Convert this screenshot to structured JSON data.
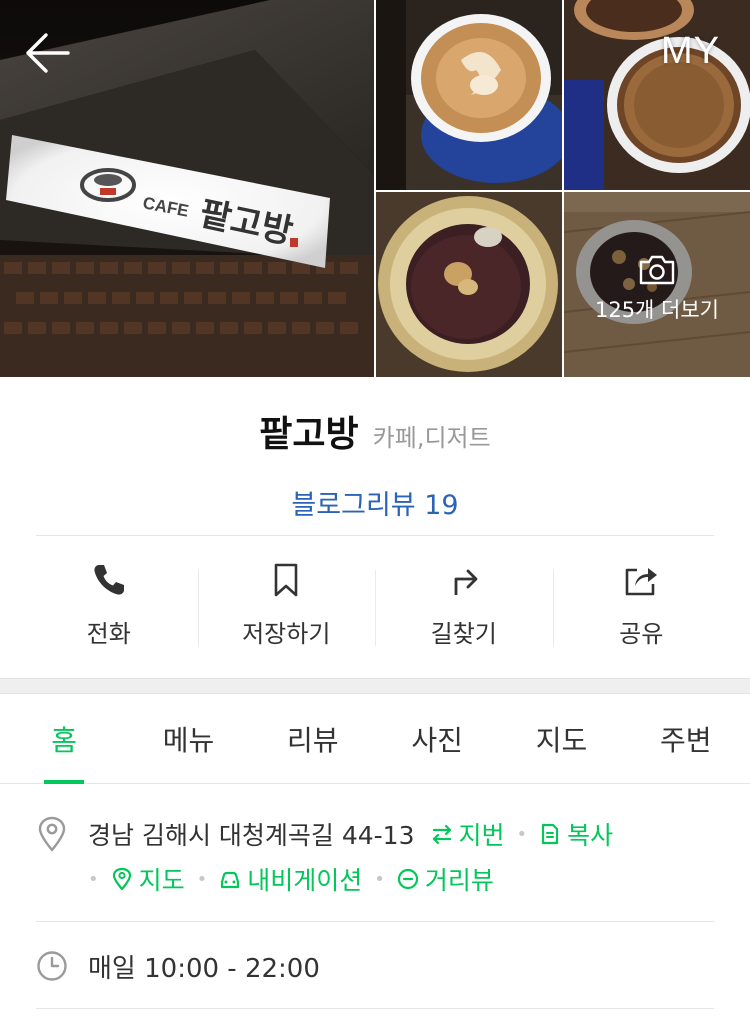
{
  "header": {
    "my_label": "MY",
    "more_photos_label": "125개 더보기",
    "main_sign": {
      "cafe_text": "CAFE",
      "shop_text": "팥고방"
    }
  },
  "place": {
    "name": "팥고방",
    "category": "카페,디저트",
    "blog_review": "블로그리뷰 19"
  },
  "actions": [
    {
      "label": "전화",
      "icon": "phone-icon"
    },
    {
      "label": "저장하기",
      "icon": "bookmark-icon"
    },
    {
      "label": "길찾기",
      "icon": "directions-icon"
    },
    {
      "label": "공유",
      "icon": "share-icon"
    }
  ],
  "tabs": [
    {
      "label": "홈",
      "active": true
    },
    {
      "label": "메뉴"
    },
    {
      "label": "리뷰"
    },
    {
      "label": "사진"
    },
    {
      "label": "지도"
    },
    {
      "label": "주변"
    }
  ],
  "info": {
    "address": "경남 김해시 대청계곡길 44-13",
    "jibun_label": "지번",
    "copy_label": "복사",
    "map_label": "지도",
    "navigation_label": "내비게이션",
    "streetview_label": "거리뷰",
    "hours": "매일 10:00 - 22:00"
  },
  "colors": {
    "accent_green": "#03c75a",
    "link_blue": "#2b63b6"
  }
}
